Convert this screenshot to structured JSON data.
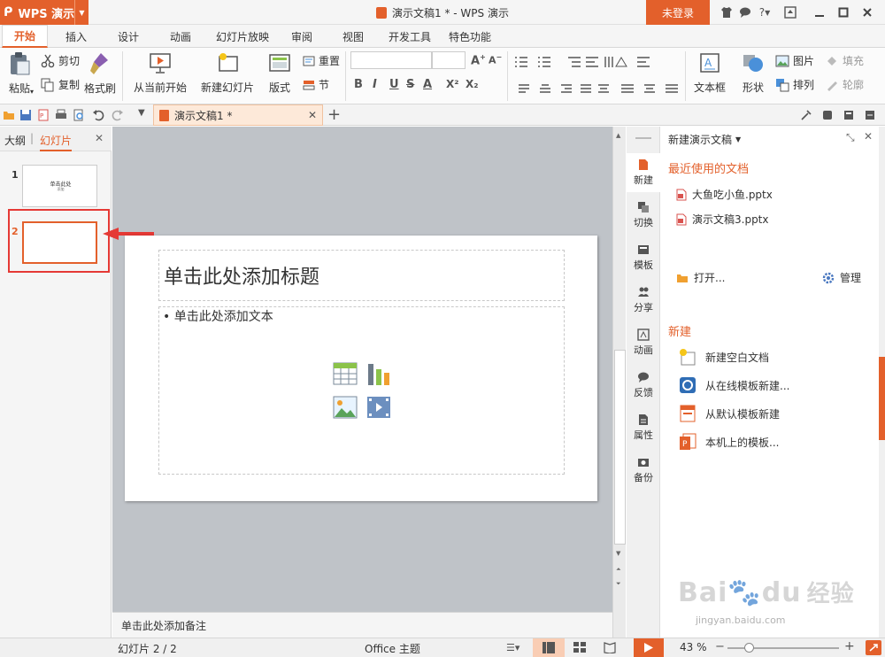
{
  "app": {
    "name": "WPS 演示",
    "window_title": "演示文稿1 * - WPS 演示",
    "login_label": "未登录",
    "help_label": "?"
  },
  "ribbon_tabs": [
    "开始",
    "插入",
    "设计",
    "动画",
    "幻灯片放映",
    "审阅",
    "视图",
    "开发工具",
    "特色功能"
  ],
  "ribbon": {
    "paste": "粘贴",
    "cut": "剪切",
    "copy": "复制",
    "format_painter": "格式刷",
    "from_current": "从当前开始",
    "new_slide": "新建幻灯片",
    "layout": "版式",
    "reset": "重置",
    "section": "节",
    "textbox": "文本框",
    "shape": "形状",
    "picture": "图片",
    "arrange": "排列",
    "fill": "填充",
    "outline": "轮廓",
    "format_buttons": [
      "B",
      "I",
      "U",
      "S",
      "A",
      "X²",
      "X₂"
    ]
  },
  "doc_tab": {
    "label": "演示文稿1 *"
  },
  "left_panel": {
    "tab_outline": "大纲",
    "tab_slides": "幻灯片",
    "slide_numbers": [
      "1",
      "2"
    ],
    "thumb1_title": "单击此处",
    "thumb1_sub": "添加"
  },
  "slide": {
    "title_placeholder": "单击此处添加标题",
    "body_placeholder": "• 单击此处添加文本"
  },
  "notes_placeholder": "单击此处添加备注",
  "side_tabs": [
    "新建",
    "切换",
    "模板",
    "分享",
    "动画",
    "反馈",
    "属性",
    "备份"
  ],
  "task_pane": {
    "header": "新建演示文稿",
    "recent_heading": "最近使用的文档",
    "recent_files": [
      "大鱼吃小鱼.pptx",
      "演示文稿3.pptx"
    ],
    "open_label": "打开...",
    "manage_label": "管理",
    "new_heading": "新建",
    "new_items": [
      "新建空白文档",
      "从在线模板新建...",
      "从默认模板新建",
      "本机上的模板..."
    ]
  },
  "status": {
    "slide_counter": "幻灯片 2 / 2",
    "theme": "Office 主题",
    "zoom": "43 %"
  },
  "watermark": {
    "brand": "Bai",
    "brand2": "du",
    "cn": "经验",
    "url": "jingyan.baidu.com"
  },
  "colors": {
    "accent": "#e3602b",
    "highlight_red": "#e53935"
  }
}
